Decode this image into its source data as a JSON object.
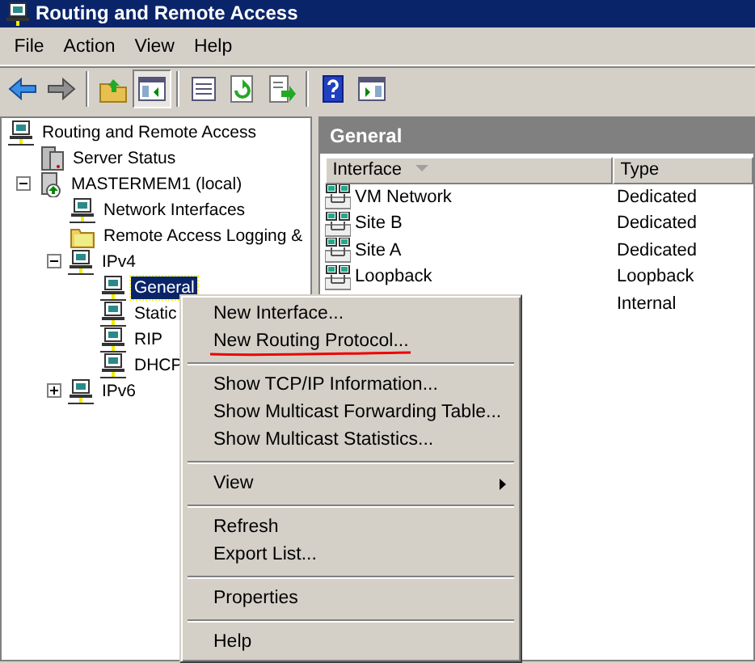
{
  "window": {
    "title": "Routing and Remote Access"
  },
  "menu_bar": [
    {
      "label": "File"
    },
    {
      "label": "Action"
    },
    {
      "label": "View"
    },
    {
      "label": "Help"
    }
  ],
  "toolbar": [
    {
      "kind": "back",
      "pressed": false
    },
    {
      "kind": "forward",
      "pressed": false
    },
    {
      "kind": "separator"
    },
    {
      "kind": "up",
      "pressed": false
    },
    {
      "kind": "console-tree",
      "pressed": true
    },
    {
      "kind": "separator"
    },
    {
      "kind": "properties",
      "pressed": false
    },
    {
      "kind": "refresh",
      "pressed": false
    },
    {
      "kind": "export",
      "pressed": false
    },
    {
      "kind": "separator"
    },
    {
      "kind": "help",
      "pressed": false
    },
    {
      "kind": "action-pane",
      "pressed": false
    }
  ],
  "tree": [
    {
      "label": "Routing and Remote Access",
      "kind": "network",
      "selected": false,
      "children": [
        {
          "label": "Server Status",
          "kind": "status",
          "selected": false
        },
        {
          "label": "MASTERMEM1 (local)",
          "kind": "server",
          "selected": false,
          "expanded": true,
          "children": [
            {
              "label": "Network Interfaces",
              "kind": "network",
              "selected": false
            },
            {
              "label": "Remote Access Logging &",
              "kind": "folder",
              "selected": false
            },
            {
              "label": "IPv4",
              "kind": "network",
              "selected": false,
              "expanded": true,
              "children": [
                {
                  "label": "General",
                  "kind": "network",
                  "selected": true
                },
                {
                  "label": "Static",
                  "kind": "network",
                  "selected": false
                },
                {
                  "label": "RIP",
                  "kind": "network",
                  "selected": false
                },
                {
                  "label": "DHCP",
                  "kind": "network",
                  "selected": false
                }
              ]
            },
            {
              "label": "IPv6",
              "kind": "network",
              "selected": false,
              "expanded": false
            }
          ]
        }
      ]
    }
  ],
  "details": {
    "title": "General",
    "columns": [
      {
        "label": "Interface",
        "sorted": true
      },
      {
        "label": "Type",
        "sorted": false
      }
    ],
    "rows": [
      {
        "interface": "VM Network",
        "type": "Dedicated"
      },
      {
        "interface": "Site B",
        "type": "Dedicated"
      },
      {
        "interface": "Site A",
        "type": "Dedicated"
      },
      {
        "interface": "Loopback",
        "type": "Loopback"
      },
      {
        "type": "Internal"
      }
    ]
  },
  "context_menu": {
    "groups": [
      [
        {
          "label": "New Interface..."
        },
        {
          "label": "New Routing Protocol...",
          "annotated": true
        }
      ],
      [
        {
          "label": "Show TCP/IP Information..."
        },
        {
          "label": "Show Multicast Forwarding Table..."
        },
        {
          "label": "Show Multicast Statistics..."
        }
      ],
      [
        {
          "label": "View",
          "submenu": true
        }
      ],
      [
        {
          "label": "Refresh"
        },
        {
          "label": "Export List..."
        }
      ],
      [
        {
          "label": "Properties"
        }
      ],
      [
        {
          "label": "Help"
        }
      ]
    ]
  }
}
